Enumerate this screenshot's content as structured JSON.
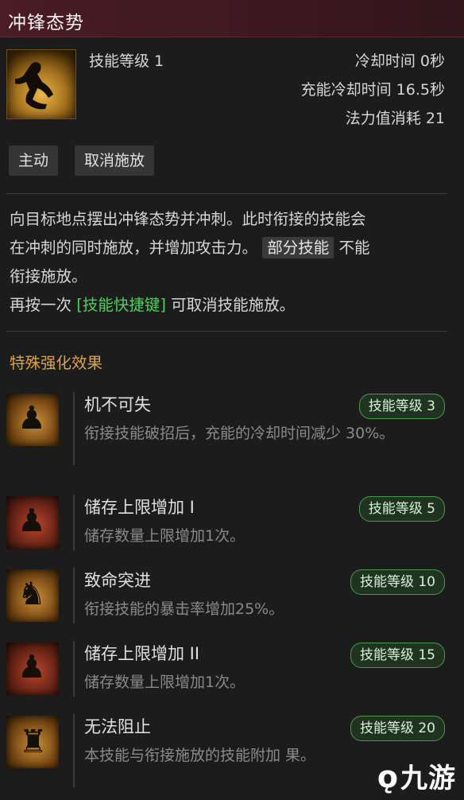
{
  "skill": {
    "title": "冲锋态势",
    "icon": "charge-stance-icon",
    "level_label": "技能等级 1",
    "cooldown": "冷却时间 0秒",
    "charge_cooldown": "充能冷却时间 16.5秒",
    "mana_cost": "法力值消耗 21"
  },
  "tags": [
    "主动",
    "取消施放"
  ],
  "description": {
    "line1": "向目标地点摆出冲锋态势并冲刺。此时衔接的技能会",
    "line2a": "在冲刺的同时施放，并增加攻击力。",
    "line2_chip": "部分技能",
    "line2b": "不能",
    "line3": "衔接施放。",
    "line4a": "再按一次",
    "line4_hotkey": "[技能快捷键]",
    "line4b": "可取消技能施放。"
  },
  "section_title": "特殊强化效果",
  "effects": [
    {
      "name": "机不可失",
      "level": "技能等级 3",
      "text": "衔接技能破招后，充能的冷却时间减少 30%。",
      "icon": "opportunity-icon"
    },
    {
      "name": "储存上限增加 I",
      "level": "技能等级 5",
      "text": "储存数量上限增加1次。",
      "icon": "storage-up-icon"
    },
    {
      "name": "致命突进",
      "level": "技能等级 10",
      "text": "衔接技能的暴击率增加25%。",
      "icon": "lethal-dash-icon"
    },
    {
      "name": "储存上限增加 II",
      "level": "技能等级 15",
      "text": "储存数量上限增加1次。",
      "icon": "storage-up-icon"
    },
    {
      "name": "无法阻止",
      "level": "技能等级 20",
      "text": "本技能与衔接施放的技能附加 果。",
      "icon": "unstoppable-icon"
    }
  ],
  "watermark": "九游",
  "colors": {
    "title_bar": "#4a1c24",
    "section_title": "#e0a24a",
    "hotkey": "#4fd05a",
    "level_badge_border": "#4a9a4e"
  }
}
